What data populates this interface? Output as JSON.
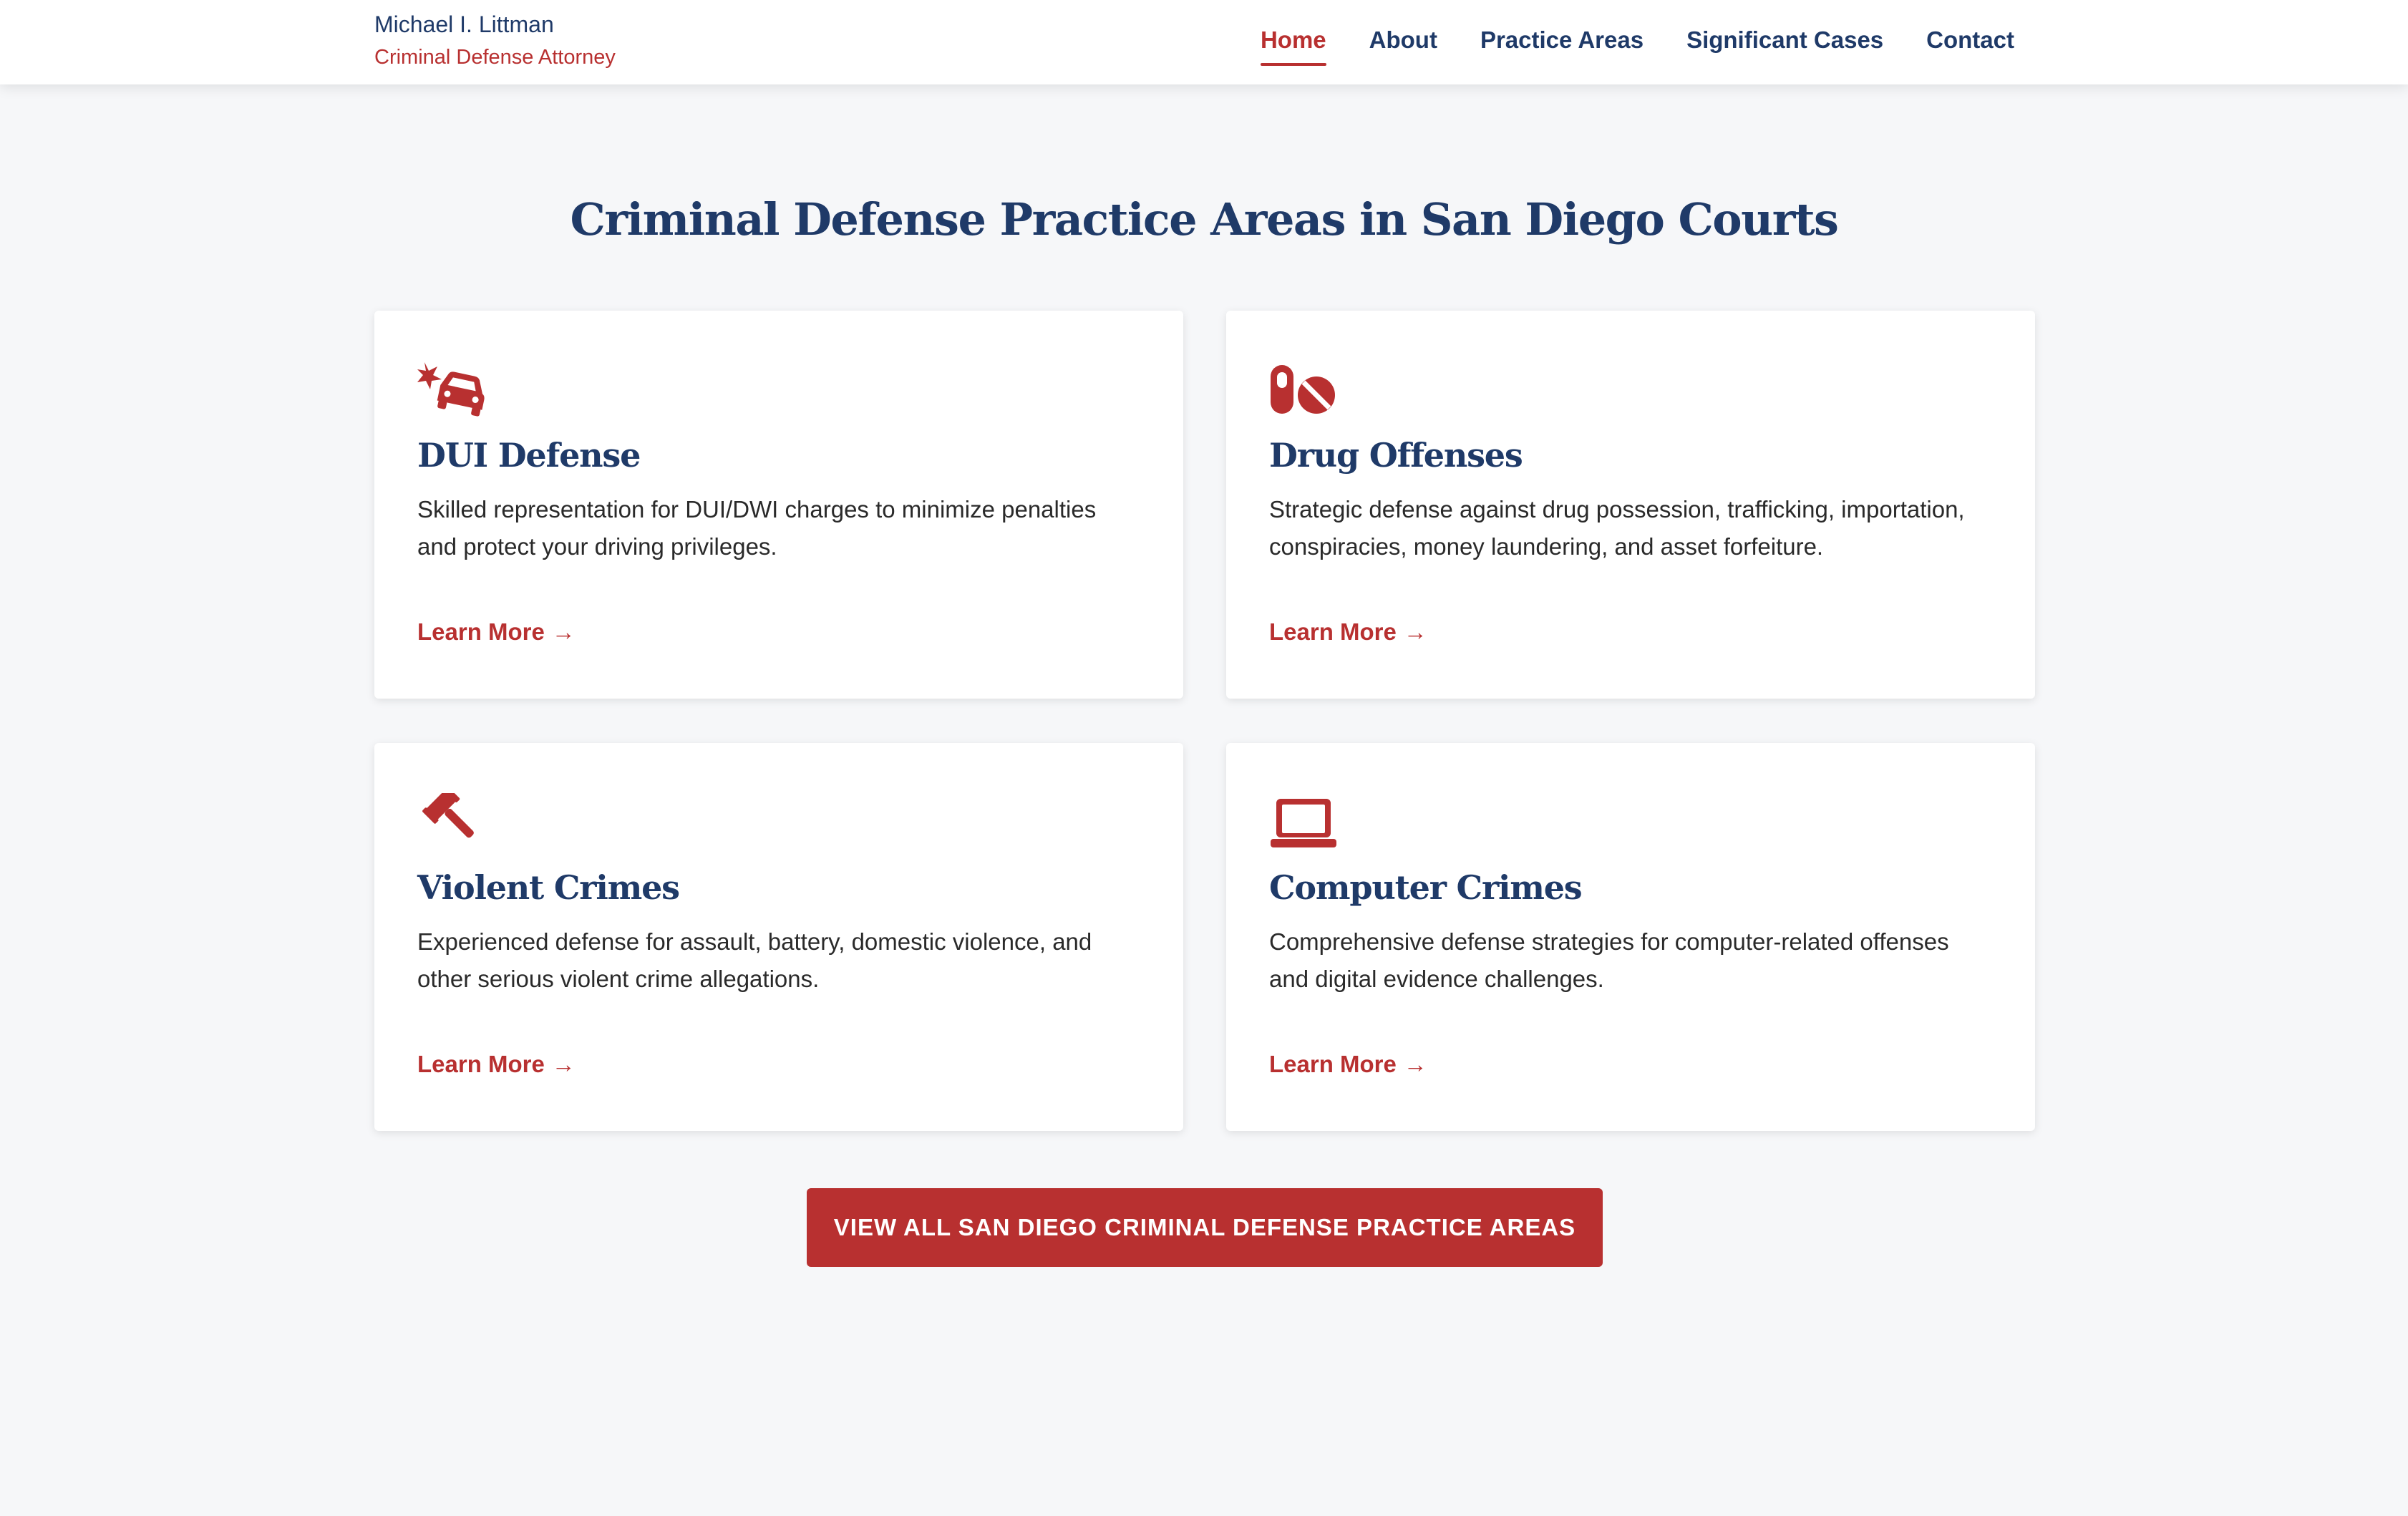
{
  "brand": {
    "name": "Michael I. Littman",
    "tagline": "Criminal Defense Attorney"
  },
  "nav": {
    "items": [
      {
        "label": "Home",
        "active": true
      },
      {
        "label": "About",
        "active": false
      },
      {
        "label": "Practice Areas",
        "active": false
      },
      {
        "label": "Significant Cases",
        "active": false
      },
      {
        "label": "Contact",
        "active": false
      }
    ]
  },
  "section": {
    "title": "Criminal Defense Practice Areas in San Diego Courts"
  },
  "cards": [
    {
      "icon": "car-crash-icon",
      "title": "DUI Defense",
      "description": "Skilled representation for DUI/DWI charges to minimize penalties and protect your driving privileges.",
      "link_label": "Learn More",
      "link_arrow": "→"
    },
    {
      "icon": "pills-icon",
      "title": "Drug Offenses",
      "description": "Strategic defense against drug possession, trafficking, importation, conspiracies, money laundering, and asset forfeiture.",
      "link_label": "Learn More",
      "link_arrow": "→"
    },
    {
      "icon": "gavel-icon",
      "title": "Violent Crimes",
      "description": "Experienced defense for assault, battery, domestic violence, and other serious violent crime allegations.",
      "link_label": "Learn More",
      "link_arrow": "→"
    },
    {
      "icon": "laptop-icon",
      "title": "Computer Crimes",
      "description": "Comprehensive defense strategies for computer-related offenses and digital evidence challenges.",
      "link_label": "Learn More",
      "link_arrow": "→"
    }
  ],
  "cta": {
    "label": "VIEW ALL SAN DIEGO CRIMINAL DEFENSE PRACTICE AREAS"
  },
  "colors": {
    "navy": "#1f3a68",
    "accent_red": "#b83030",
    "background": "#f6f7f9",
    "card": "#ffffff"
  }
}
